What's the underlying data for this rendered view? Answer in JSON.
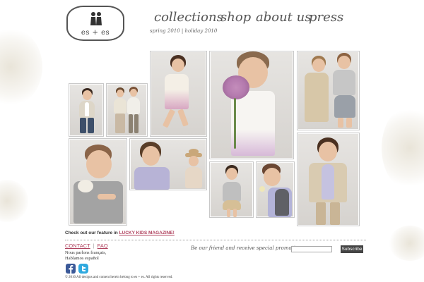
{
  "logo": {
    "text": "es + es"
  },
  "nav": {
    "collections": "collections",
    "shop": "shop",
    "about": "about us",
    "press": "press",
    "season": "spring 2010 | holiday 2010"
  },
  "feature": {
    "prefix": "Check out our feature in ",
    "link": "LUCKY KIDS MAGAZINE!"
  },
  "footer_links": {
    "contact": "CONTACT",
    "separator": "|",
    "faq": "FAQ"
  },
  "languages": {
    "line1": "Nous parlons français,",
    "line2": "Hablamos español"
  },
  "newsletter": {
    "prompt": "Be our friend and receive special promotions",
    "email_value": "",
    "subscribe_label": "Subscribe"
  },
  "social": {
    "facebook_icon": "facebook-icon",
    "twitter_icon": "twitter-icon"
  },
  "copyright": "© 2010 All designs and content herein belong to es + es. All rights reserved.",
  "colors": {
    "link": "#b0435f",
    "button": "#444444",
    "facebook": "#3b5998",
    "twitter": "#2fa9df"
  }
}
